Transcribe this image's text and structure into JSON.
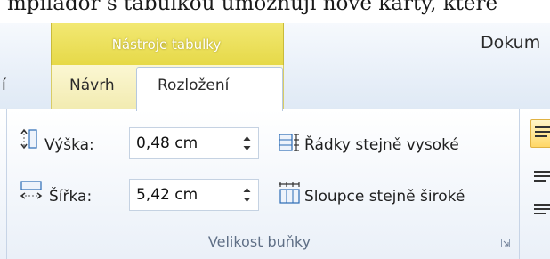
{
  "background_text": "mpiládoř s tabulkou umožňují nové karty, které",
  "ribbon": {
    "contextual_label": "Nástroje tabulky",
    "document_label": "Dokum",
    "tabs": {
      "left_partial": "í",
      "design": "Návrh",
      "layout": "Rozložení"
    }
  },
  "cell_size": {
    "height_label": "Výška:",
    "height_value": "0,48 cm",
    "width_label": "Šířka:",
    "width_value": "5,42 cm",
    "distribute_rows": "Řádky stejně vysoké",
    "distribute_columns": "Sloupce stejně široké",
    "group_title": "Velikost buňky"
  },
  "colors": {
    "contextual_header": "#e6d948",
    "ribbon_border": "#b6c8df",
    "accent_blue": "#2b6bb5"
  }
}
